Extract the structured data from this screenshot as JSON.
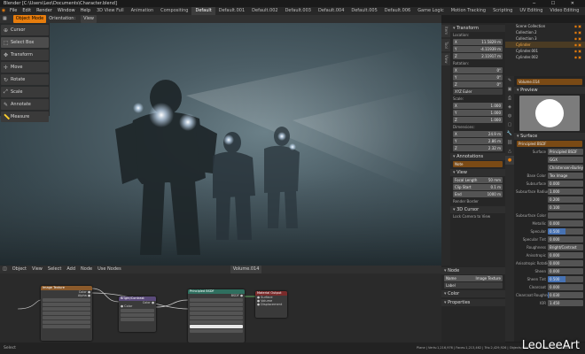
{
  "window": {
    "title": "Blender [C:\\Users\\Leo\\Documents\\Character.blend]"
  },
  "menu": {
    "items": [
      "File",
      "Edit",
      "Render",
      "Window",
      "Help"
    ],
    "workspaces": [
      "3D View Full",
      "Animation",
      "Compositing",
      "Default",
      "Default.001",
      "Default.002",
      "Default.003",
      "Default.004",
      "Default.005",
      "Default.006",
      "Game Logic",
      "Motion Tracking",
      "Scripting",
      "UV Editing",
      "Video Editing"
    ],
    "active_workspace": "Default"
  },
  "viewport_header": {
    "mode_label": "Object Mode",
    "orientation_label": "Orientation:",
    "orientation_value": "View"
  },
  "toolbar": {
    "tools": [
      {
        "label": "Cursor",
        "icon": "cursor-icon"
      },
      {
        "label": "Select Box",
        "icon": "select-box-icon"
      },
      {
        "label": "Transform",
        "icon": "transform-icon"
      },
      {
        "label": "Move",
        "icon": "move-icon"
      },
      {
        "label": "Rotate",
        "icon": "rotate-icon"
      },
      {
        "label": "Scale",
        "icon": "scale-icon"
      },
      {
        "label": "Annotate",
        "icon": "annotate-icon"
      },
      {
        "label": "Measure",
        "icon": "measure-icon"
      }
    ]
  },
  "npanel": {
    "tabs": [
      "Item",
      "Tool",
      "View"
    ],
    "transform_title": "Transform",
    "location_label": "Location:",
    "location": [
      "11.5829 m",
      "-4.11939 m",
      "2.11917 m"
    ],
    "rotation_label": "Rotation:",
    "rotation": [
      "0°",
      "0°",
      "0°"
    ],
    "rotation_mode": "XYZ Euler",
    "scale_label": "Scale:",
    "scale": [
      "1.000",
      "1.000",
      "1.000"
    ],
    "dimensions_label": "Dimensions:",
    "dimensions": [
      "24.9 m",
      "2.86 m",
      "2.32 m"
    ],
    "annotations_title": "Annotations",
    "annotation_layer": "Note",
    "view_title": "View",
    "focal_length_label": "Focal Length",
    "focal_length": "50 mm",
    "clip_start_label": "Clip Start",
    "clip_start": "0.1 m",
    "clip_end_label": "End",
    "clip_end": "1000 m",
    "render_border_label": "Render Border",
    "cursor_title": "3D Cursor",
    "lock_camera_label": "Lock Camera to View"
  },
  "outliner": {
    "rows": [
      {
        "name": "Scene Collection",
        "selected": false
      },
      {
        "name": "Collection 2",
        "selected": false
      },
      {
        "name": "Collection 3",
        "selected": false
      },
      {
        "name": "Cylinder",
        "selected": true
      },
      {
        "name": "Cylinder.001",
        "selected": false
      },
      {
        "name": "Cylinder.002",
        "selected": false
      }
    ]
  },
  "properties": {
    "material_name": "Volume.014",
    "preview_title": "Preview",
    "surface_title": "Surface",
    "surface_shader": "Principled BSDF",
    "rows": [
      {
        "key": "Surface",
        "value": "Principled BSDF",
        "fill": 0
      },
      {
        "key": "",
        "value": "GGX",
        "fill": 0
      },
      {
        "key": "",
        "value": "Christensen-Burley",
        "fill": 0
      },
      {
        "key": "Base Color",
        "value": "Tex Image",
        "fill": 0
      },
      {
        "key": "Subsurface",
        "value": "0.000",
        "fill": 0
      },
      {
        "key": "Subsurface Radius",
        "value": "1.000",
        "fill": 0
      },
      {
        "key": "",
        "value": "0.200",
        "fill": 0
      },
      {
        "key": "",
        "value": "0.100",
        "fill": 0
      },
      {
        "key": "Subsurface Color",
        "value": "",
        "fill": 0
      },
      {
        "key": "Metallic",
        "value": "0.000",
        "fill": 0
      },
      {
        "key": "Specular",
        "value": "0.500",
        "fill": 50
      },
      {
        "key": "Specular Tint",
        "value": "0.000",
        "fill": 0
      },
      {
        "key": "Roughness",
        "value": "Bright/Contrast",
        "fill": 0
      },
      {
        "key": "Anisotropic",
        "value": "0.000",
        "fill": 0
      },
      {
        "key": "Anisotropic Rotation",
        "value": "0.000",
        "fill": 0
      },
      {
        "key": "Sheen",
        "value": "0.000",
        "fill": 0
      },
      {
        "key": "Sheen Tint",
        "value": "0.500",
        "fill": 50
      },
      {
        "key": "Clearcoat",
        "value": "0.000",
        "fill": 0
      },
      {
        "key": "Clearcoat Roughness",
        "value": "0.030",
        "fill": 3
      },
      {
        "key": "IOR",
        "value": "1.450",
        "fill": 0
      }
    ]
  },
  "node_header": {
    "items": [
      "Object",
      "View",
      "Select",
      "Add",
      "Node",
      "Use Nodes"
    ],
    "material": "Volume.014"
  },
  "nodes": [
    {
      "title": "Image Texture",
      "color": "#8b5a2b"
    },
    {
      "title": "Bright/Contrast",
      "color": "#5a4a7a"
    },
    {
      "title": "Principled BSDF",
      "color": "#2f6f5f"
    },
    {
      "title": "Material Output",
      "color": "#7a2b2b"
    }
  ],
  "node_sidebar": {
    "title": "Node",
    "name_label": "Name",
    "name_value": "Image Texture",
    "label_label": "Label",
    "properties_title": "Properties",
    "color_title": "Color"
  },
  "status": {
    "left": "Select",
    "right": "Plane | Verts:1,216,976 | Faces:1,213,462 | Tris:2,429,926 | Objects:0/99 | Mem: 876.2 MB | v2.80.75"
  },
  "watermark": {
    "text": "LeoLeeArt"
  }
}
